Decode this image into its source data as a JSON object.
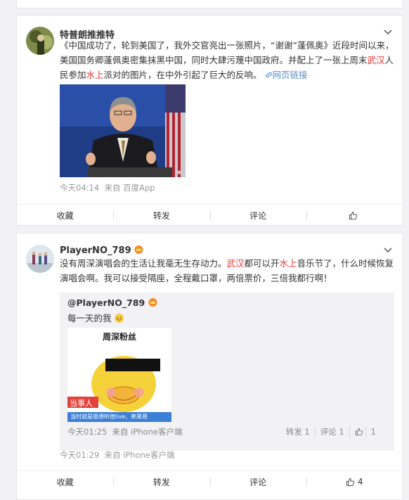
{
  "post1": {
    "author": "特普朗推推特",
    "text_parts": [
      "《中国成功了，轮到美国了，我外交官亮出一张照片，“谢谢”蓬佩奥》近段时间以来，美国国务卿蓬佩奥密集抹黑中国，同时大肆污蔑中国政府。并配上了一张上周末",
      "武汉",
      "人民参加",
      "水上",
      "派对的图片，在中外引起了巨大的反响。"
    ],
    "link_label": "网页链接",
    "time": "今天04:14",
    "source": "来自 百度App",
    "actions": {
      "collect": "收藏",
      "repost": "转发",
      "comment": "评论",
      "like": ""
    }
  },
  "post2": {
    "author": "PlayerNO_789",
    "text_parts": [
      "没有周深演唱会的生活让我毫无生存动力。",
      "武汉",
      "都可以开",
      "水上",
      "音乐节了，什么时候恢复演唱会啊。我可以接受隔座，全程戴口罩，两倍票价，三倍我都行啊！"
    ],
    "quote": {
      "author": "@PlayerNO_789",
      "text": "每一天的我",
      "image_caption_top": "周深粉丝",
      "image_tag": "当事人",
      "image_caption_bottom": "当时就是很想听他live，牵黑悬",
      "time": "今天01:25",
      "source": "来自 iPhone客户端",
      "repost": "转发 1",
      "comment": "评论 1",
      "like": "1"
    },
    "time": "今天01:29",
    "source": "来自 iPhone客户端",
    "actions": {
      "collect": "收藏",
      "repost": "转发",
      "comment": "评论",
      "like": "4"
    }
  },
  "colors": {
    "highlight": "#e33333",
    "link": "#5b8fc7"
  },
  "icons": [
    "chevron-down-icon",
    "thumbs-up-icon",
    "link-icon",
    "crown-badge-icon",
    "grin-emoji-icon",
    "weibo-watermark-icon"
  ]
}
